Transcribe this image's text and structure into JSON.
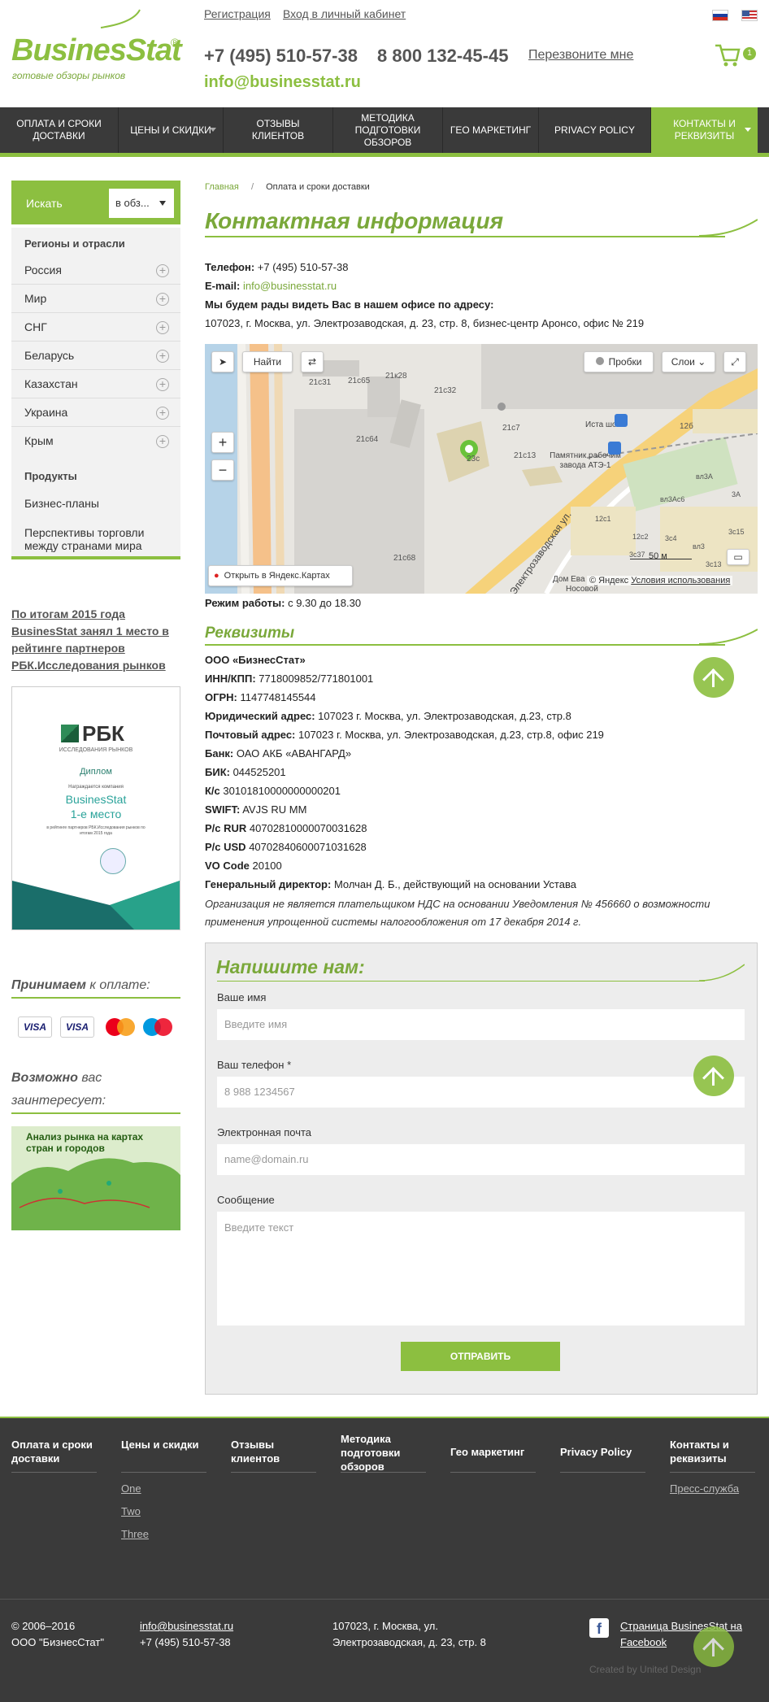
{
  "header": {
    "logo_text": "BusinesStat",
    "logo_reg": "®",
    "tagline": "готовые обзоры рынков",
    "register": "Регистрация",
    "login": "Вход в личный кабинет",
    "phone1": "+7 (495) 510-57-38",
    "phone2": "8 800 132-45-45",
    "callback": "Перезвоните мне",
    "email": "info@businesstat.ru",
    "cart_count": "1"
  },
  "nav": [
    {
      "label": "ОПЛАТА И СРОКИ ДОСТАВКИ"
    },
    {
      "label": "ЦЕНЫ И СКИДКИ"
    },
    {
      "label": "ОТЗЫВЫ КЛИЕНТОВ"
    },
    {
      "label": "МЕТОДИКА ПОДГОТОВКИ ОБЗОРОВ"
    },
    {
      "label": "ГЕО МАРКЕТИНГ"
    },
    {
      "label": "PRIVACY POLICY"
    },
    {
      "label": "КОНТАКТЫ И РЕКВИЗИТЫ"
    }
  ],
  "sidebar": {
    "search_label": "Искать",
    "search_select": "в обз...",
    "regions_title": "Регионы и отрасли",
    "regions": [
      "Россия",
      "Мир",
      "СНГ",
      "Беларусь",
      "Казахстан",
      "Украина",
      "Крым"
    ],
    "products_title": "Продукты",
    "products": [
      "Бизнес-планы",
      "Перспективы торговли между странами мира"
    ],
    "rbk_text": "По итогам 2015 года BusinesStat занял 1 место в рейтинге партнеров РБК.Исследования рынков",
    "diploma": {
      "brand": "РБК",
      "brand_sub": "ИССЛЕДОВАНИЯ РЫНКОВ",
      "title": "Диплом",
      "line1": "Награждается компания",
      "company": "BusinesStat",
      "place": "1-е место",
      "line2": "в рейтинге партнеров РБК.Исследования рынков по итогам 2015 года"
    },
    "payment_title_bold": "Принимаем",
    "payment_title_rest": " к оплате:",
    "cards": [
      "VISA",
      "VISA",
      "MasterCard",
      "Maestro"
    ],
    "interest_bold": "Возможно",
    "interest_rest": " вас заинтересует:",
    "promo_text": "Анализ рынка на картах стран и городов"
  },
  "main": {
    "breadcrumb_home": "Главная",
    "breadcrumb_sep": "/",
    "breadcrumb_current": "Оплата и сроки доставки",
    "title": "Контактная информация",
    "phone_label": "Телефон:",
    "phone_value": " +7 (495) 510-57-38",
    "email_label": "E-mail:",
    "email_value": "info@businesstat.ru",
    "office_text": "Мы будем рады видеть Вас в нашем офисе по адресу:",
    "address": "107023, г. Москва, ул. Электрозаводская, д. 23, стр. 8, бизнес-центр Аронсо, офис № 219",
    "hours_label": "Режим работы:",
    "hours_value": " с 9.30 до 18.30",
    "map": {
      "find": "Найти",
      "traffic": "Пробки",
      "layers": "Слои",
      "open_in": "Открыть в Яндекс.Картах",
      "scale": "50 м",
      "copyright": "© Яндекс",
      "terms": "Условия использования",
      "street": "Электрозаводская ул.",
      "labels": [
        "21с31",
        "21с65",
        "21к28",
        "21с32",
        "21с64",
        "23с",
        "21с7",
        "21с13",
        "Иста шоп",
        "Памятник рабочим завода АТЭ-1",
        "12б",
        "вл3А",
        "вл3Ас6",
        "12с1",
        "12с2",
        "3с4",
        "3с37",
        "3с15",
        "3с13",
        "21с68",
        "Дом Ева",
        "Носовой",
        "3А",
        "вл3"
      ]
    },
    "req_title": "Реквизиты",
    "requisites": [
      {
        "label": "ООО «БизнесСтат»",
        "value": ""
      },
      {
        "label": "ИНН/КПП:",
        "value": " 7718009852/771801001"
      },
      {
        "label": "ОГРН:",
        "value": " 1147748145544"
      },
      {
        "label": "Юридический адрес:",
        "value": " 107023 г. Москва, ул. Электрозаводская, д.23, стр.8"
      },
      {
        "label": "Почтовый адрес:",
        "value": " 107023 г. Москва, ул. Электрозаводская, д.23, стр.8, офис 219"
      },
      {
        "label": "Банк:",
        "value": " ОАО АКБ «АВАНГАРД»"
      },
      {
        "label": "БИК:",
        "value": " 044525201"
      },
      {
        "label": "К/с",
        "value": " 30101810000000000201"
      },
      {
        "label": "SWIFT:",
        "value": " AVJS RU MM"
      },
      {
        "label": "Р/с RUR",
        "value": " 40702810000070031628"
      },
      {
        "label": "Р/с USD",
        "value": " 40702840600071031628"
      },
      {
        "label": "VO Code",
        "value": " 20100"
      },
      {
        "label": "Генеральный директор:",
        "value": " Молчан Д. Б., действующий на основании Устава"
      }
    ],
    "req_note": "Организация не является плательщиком НДС на основании Уведомления № 456660 о возможности применения упрощенной системы налогообложения от 17 декабря 2014 г."
  },
  "form": {
    "title": "Напишите нам:",
    "name_label": "Ваше имя",
    "name_placeholder": "Введите имя",
    "phone_label": "Ваш телефон *",
    "phone_placeholder": "8 988 1234567",
    "email_label": "Электронная почта",
    "email_placeholder": "name@domain.ru",
    "message_label": "Сообщение",
    "message_placeholder": "Введите текст",
    "submit": "ОТПРАВИТЬ"
  },
  "footer": {
    "cols": [
      "Оплата и сроки доставки",
      "Цены и скидки",
      "Отзывы клиентов",
      "Методика подготовки обзоров",
      "Гео маркетинг",
      "Privacy Policy",
      "Контакты и реквизиты"
    ],
    "prices_sub": [
      "One",
      "Two",
      "Three"
    ],
    "contacts_sub": [
      "Пресс-служба"
    ],
    "copyright": "© 2006–2016",
    "company": "ООО \"БизнесСтат\"",
    "email": "info@businesstat.ru",
    "phone": "+7 (495) 510-57-38",
    "address": "107023, г. Москва, ул. Электрозаводская, д. 23, стр. 8",
    "facebook": "Страница BusinesStat на Facebook",
    "created_by": "Created by United Design"
  },
  "colors": {
    "accent": "#8cbf40",
    "dark": "#3a3a3a",
    "title_green": "#7aa83a"
  }
}
